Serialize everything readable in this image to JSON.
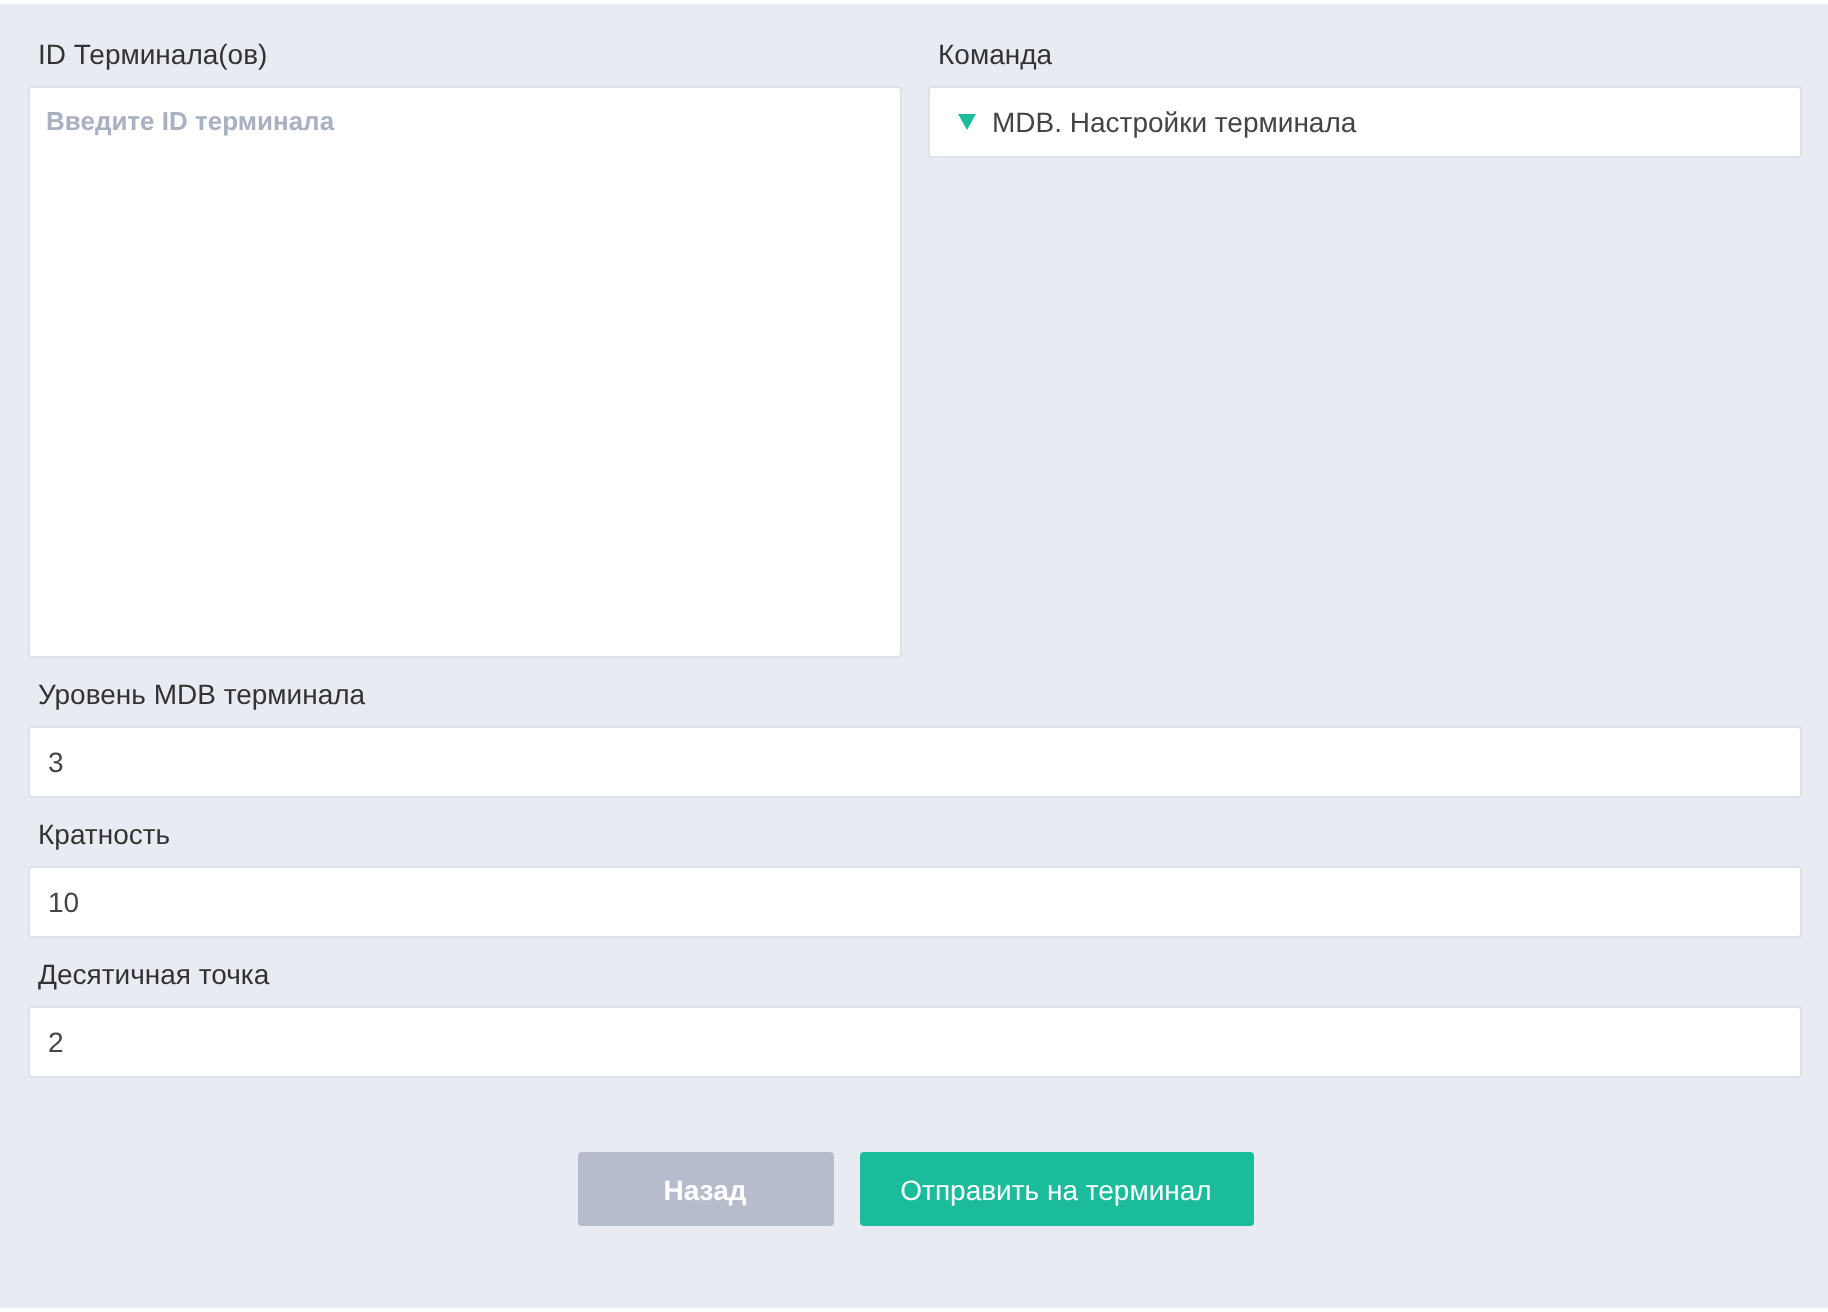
{
  "terminal_ids": {
    "label": "ID Терминала(ов)",
    "placeholder": "Введите ID терминала"
  },
  "command": {
    "label": "Команда",
    "value": "MDB. Настройки терминала"
  },
  "fields": [
    {
      "label": "Уровень MDB терминала",
      "value": "3"
    },
    {
      "label": "Кратность",
      "value": "10"
    },
    {
      "label": "Десятичная точка",
      "value": "2"
    }
  ],
  "buttons": [
    {
      "label": "Назад",
      "kind": "secondary"
    },
    {
      "label": "Отправить на терминал",
      "kind": "primary"
    }
  ]
}
